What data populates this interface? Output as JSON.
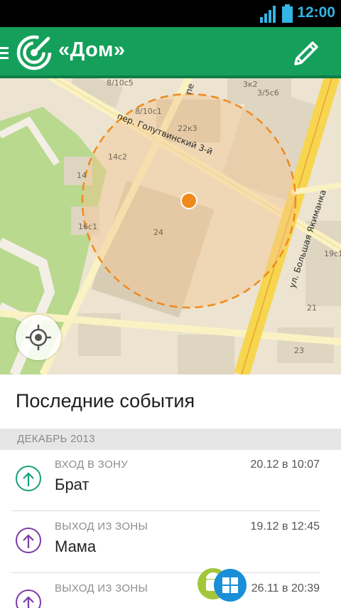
{
  "status": {
    "time": "12:00"
  },
  "appbar": {
    "title": "«Дом»"
  },
  "map": {
    "buildings": [
      "8/10с5",
      "8/10с1",
      "3к2",
      "3/5с6",
      "22к3",
      "14с2",
      "14",
      "24",
      "16с1",
      "19с1",
      "21",
      "23"
    ],
    "streets": {
      "golutvinsky": "пер. Голутвинский 3-й",
      "yakimanka": "ул. Большая Якиманка",
      "per": "пе"
    },
    "accent": "#f08a1c"
  },
  "events": {
    "heading": "Последние события",
    "section": "ДЕКАБРЬ 2013",
    "items": [
      {
        "type": "ВХОД В ЗОНУ",
        "name": "Брат",
        "time": "20.12 в 10:07",
        "color": "#14a07a",
        "icon": "arrow-up-icon"
      },
      {
        "type": "ВЫХОД ИЗ ЗОНЫ",
        "name": "Мама",
        "time": "19.12 в 12:45",
        "color": "#7b3ba6",
        "icon": "arrow-up-icon"
      },
      {
        "type": "ВЫХОД ИЗ ЗОНЫ",
        "name": "",
        "time": "26.11 в 20:39",
        "color": "#7b3ba6",
        "icon": "arrow-up-icon"
      }
    ]
  }
}
